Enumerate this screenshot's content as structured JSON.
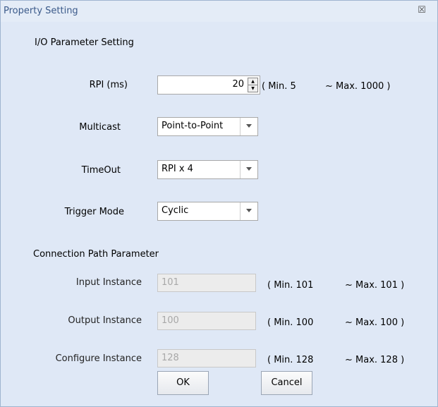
{
  "window": {
    "title": "Property Setting",
    "close_glyph": "☒"
  },
  "io_section": {
    "title": "I/O Parameter Setting"
  },
  "rpi": {
    "label": "RPI (ms)",
    "value": "20",
    "range_min": "( Min. 5",
    "range_max": "~ Max. 1000  )"
  },
  "multicast": {
    "label": "Multicast",
    "value": "Point-to-Point"
  },
  "timeout": {
    "label": "TimeOut",
    "value": "RPI x 4"
  },
  "trigger": {
    "label": "Trigger Mode",
    "value": "Cyclic"
  },
  "conn_section": {
    "title": "Connection Path Parameter"
  },
  "input_instance": {
    "label": "Input Instance",
    "value": "101",
    "range_min": "( Min.  101",
    "range_max": "~ Max. 101   )"
  },
  "output_instance": {
    "label": "Output Instance",
    "value": "100",
    "range_min": "( Min.  100",
    "range_max": "~ Max. 100   )"
  },
  "configure_instance": {
    "label": "Configure Instance",
    "value": "128",
    "range_min": "( Min.  128",
    "range_max": "~ Max. 128   )"
  },
  "buttons": {
    "ok": "OK",
    "cancel": "Cancel"
  },
  "colors": {
    "dialog_bg": "#dfe8f6",
    "title_text": "#3b5a8a",
    "disabled_text": "#a8a8a8"
  }
}
